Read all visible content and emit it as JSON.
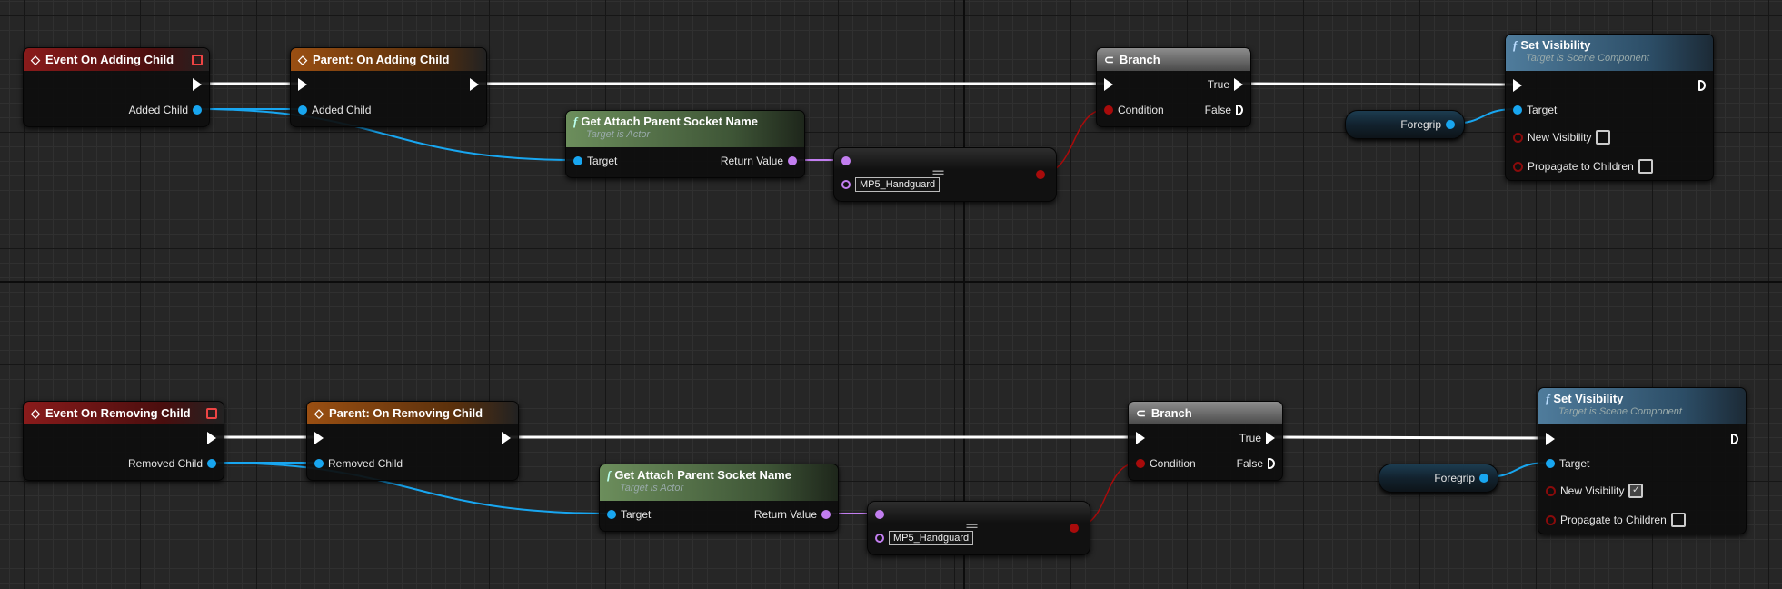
{
  "graphs": [
    {
      "event": {
        "title": "Event On Adding Child",
        "output": "Added Child"
      },
      "parent_call": {
        "title": "Parent: On Adding Child",
        "input": "Added Child"
      },
      "get_socket": {
        "title": "Get Attach Parent Socket Name",
        "subtitle": "Target is Actor",
        "input": "Target",
        "output": "Return Value"
      },
      "equal": {
        "symbol": "==",
        "value": "MP5_Handguard"
      },
      "branch": {
        "title": "Branch",
        "condition": "Condition",
        "true_label": "True",
        "false_label": "False"
      },
      "variable": {
        "name": "Foregrip"
      },
      "set_visibility": {
        "title": "Set Visibility",
        "subtitle": "Target is Scene Component",
        "target": "Target",
        "new_visibility": "New Visibility",
        "new_visibility_checked": false,
        "propagate": "Propagate to Children",
        "propagate_checked": false
      }
    },
    {
      "event": {
        "title": "Event On Removing Child",
        "output": "Removed Child"
      },
      "parent_call": {
        "title": "Parent: On Removing Child",
        "input": "Removed Child"
      },
      "get_socket": {
        "title": "Get Attach Parent Socket Name",
        "subtitle": "Target is Actor",
        "input": "Target",
        "output": "Return Value"
      },
      "equal": {
        "symbol": "==",
        "value": "MP5_Handguard"
      },
      "branch": {
        "title": "Branch",
        "condition": "Condition",
        "true_label": "True",
        "false_label": "False"
      },
      "variable": {
        "name": "Foregrip"
      },
      "set_visibility": {
        "title": "Set Visibility",
        "subtitle": "Target is Scene Component",
        "target": "Target",
        "new_visibility": "New Visibility",
        "new_visibility_checked": true,
        "propagate": "Propagate to Children",
        "propagate_checked": false
      }
    }
  ],
  "colors": {
    "exec_wire": "#ffffff",
    "object_wire": "#18a6f0",
    "name_wire": "#c27ef0",
    "bool_wire": "#a80b0b"
  }
}
